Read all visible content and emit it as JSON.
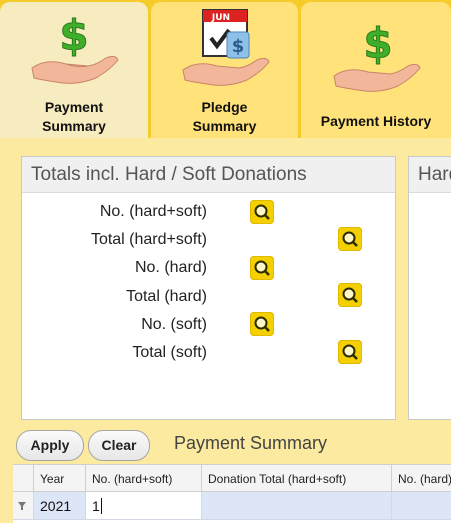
{
  "tabs": [
    {
      "label_line1": "Payment",
      "label_line2": "Summary",
      "icon": "money-hand-icon"
    },
    {
      "label_line1": "Pledge",
      "label_line2": "Summary",
      "icon": "calendar-money-hand-icon",
      "calendar_month": "JUN"
    },
    {
      "label_line1": "Payment History",
      "icon": "money-hand-icon"
    }
  ],
  "totals_panel": {
    "title": "Totals incl. Hard / Soft Donations",
    "rows": [
      {
        "label": "No. (hard+soft)"
      },
      {
        "label": "Total (hard+soft)"
      },
      {
        "label": "No. (hard)"
      },
      {
        "label": "Total (hard)"
      },
      {
        "label": "No. (soft)"
      },
      {
        "label": "Total (soft)"
      }
    ]
  },
  "second_panel": {
    "title": "Hard"
  },
  "toolbar": {
    "apply_label": "Apply",
    "clear_label": "Clear",
    "section_title": "Payment Summary"
  },
  "grid": {
    "columns": [
      "Year",
      "No. (hard+soft)",
      "Donation Total (hard+soft)",
      "No. (hard)"
    ],
    "row": {
      "year": "2021",
      "no_hard_soft": "1",
      "donation_total": "",
      "no_hard": ""
    }
  },
  "colors": {
    "tab_strip": "#f6cb2c",
    "accent_yellow": "#f5d000",
    "dollar_green": "#3fae2a",
    "selected_row": "#dde6f7"
  }
}
